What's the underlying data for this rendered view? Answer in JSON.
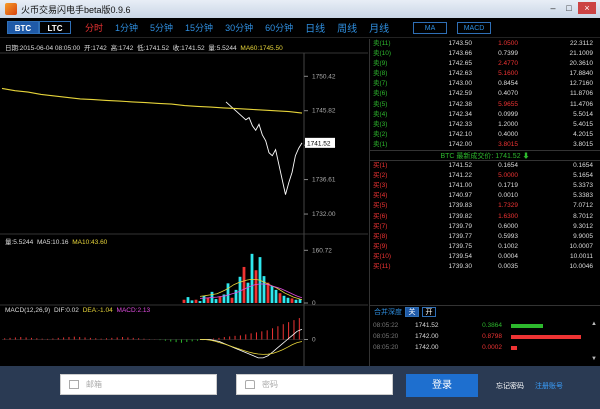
{
  "window": {
    "title": "火币交易闪电手beta版0.9.6",
    "minimize": "–",
    "maximize": "□",
    "close": "×"
  },
  "toolbar": {
    "coins": [
      "BTC",
      "LTC"
    ],
    "periods": [
      "分时",
      "1分钟",
      "5分钟",
      "15分钟",
      "30分钟",
      "60分钟",
      "日线",
      "周线",
      "月线"
    ],
    "indicators": [
      "MA",
      "MACD"
    ]
  },
  "main_info": {
    "date": "日期:2015-06-04 08:05:00",
    "open": "开:1742",
    "high": "高:1742",
    "low": "低:1741.52",
    "close": "收:1741.52",
    "volume": "量:5.5244",
    "ma60": "MA60:1745.50"
  },
  "volume_info": {
    "volume": "量:5.5244",
    "ma5": "MA5:10.16",
    "ma10": "MA10:43.60"
  },
  "macd_info": {
    "params": "MACD(12,26,9)",
    "dif": "DIF:0.02",
    "dea": "DEA:-1.04",
    "macd": "MACD:2.13"
  },
  "chart_data": [
    {
      "type": "line",
      "name": "price",
      "current_price": "1741.52",
      "y_ticks": [
        "1750.42",
        "1745.82",
        "1741.21",
        "1736.61",
        "1732.00"
      ],
      "ylim": [
        1730,
        1753
      ],
      "series": [
        {
          "name": "close",
          "color": "#ffffff",
          "values": [
            1747.0,
            1746.6,
            1746.2,
            1745.8,
            1745.4,
            1745.0,
            1744.6,
            1744.9,
            1743.8,
            1743.2,
            1744.0,
            1742.6,
            1741.8,
            1740.2,
            1739.8,
            1740.6,
            1738.6,
            1736.6,
            1734.6,
            1736.2,
            1737.6,
            1739.8,
            1740.8,
            1741.52
          ]
        },
        {
          "name": "MA60",
          "color": "#e6d43a",
          "values": [
            1748.8,
            1748.5,
            1748.3,
            1748.0,
            1747.8,
            1747.6,
            1747.4,
            1747.3,
            1747.2,
            1747.1,
            1747.0,
            1746.9,
            1746.8,
            1746.7,
            1746.5,
            1746.4,
            1746.3,
            1746.2,
            1746.1,
            1746.0,
            1745.9,
            1745.8,
            1745.7,
            1745.5
          ]
        }
      ]
    },
    {
      "type": "bar",
      "name": "volume",
      "y_ticks": [
        "160.72",
        "0"
      ],
      "ylim": [
        0,
        180
      ],
      "values": [
        0,
        0,
        0,
        0,
        0,
        0,
        0,
        0,
        0,
        0,
        0,
        0,
        0,
        0,
        0,
        0,
        0,
        0,
        0,
        0,
        0,
        0,
        0,
        0,
        0,
        0,
        0,
        0,
        0,
        0,
        0,
        0,
        0,
        0,
        0,
        0,
        0,
        0,
        0,
        0,
        0,
        0,
        0,
        0,
        0,
        10,
        18,
        8,
        10,
        6,
        22,
        16,
        34,
        12,
        20,
        26,
        60,
        16,
        40,
        80,
        110,
        62,
        150,
        100,
        140,
        82,
        62,
        52,
        40,
        30,
        22,
        16,
        14,
        10,
        12
      ],
      "series": [
        {
          "name": "MA5",
          "color": "#e6d43a",
          "values": [
            20,
            22,
            24,
            26,
            28,
            34,
            40,
            48,
            56,
            62,
            66,
            70,
            72,
            72,
            70,
            64,
            58,
            52,
            46,
            38,
            30,
            24,
            18,
            14,
            10
          ]
        },
        {
          "name": "MA10",
          "color": "#e04ce0",
          "values": [
            14,
            15,
            16,
            17,
            18,
            20,
            22,
            26,
            30,
            34,
            40,
            46,
            52,
            56,
            58,
            58,
            56,
            52,
            48,
            44,
            38,
            32,
            26,
            20,
            16
          ]
        }
      ]
    },
    {
      "type": "bar",
      "name": "MACD",
      "y_ticks": [
        "0"
      ],
      "ylim": [
        -12,
        12
      ],
      "values": [
        0.6,
        0.8,
        1.0,
        1.2,
        1.0,
        0.8,
        0.6,
        0.4,
        0.3,
        0.5,
        0.8,
        1.0,
        1.2,
        1.4,
        1.2,
        1.0,
        0.8,
        0.6,
        0.4,
        0.6,
        0.8,
        1.0,
        1.2,
        1.0,
        0.8,
        0.6,
        0.4,
        0.2,
        0.1,
        -0.3,
        -0.6,
        -1.0,
        -1.3,
        -1.6,
        -1.2,
        -0.9,
        -0.6,
        -0.3,
        0.2,
        0.5,
        0.8,
        1.2,
        1.5,
        1.8,
        2.0,
        2.5,
        3.0,
        3.5,
        4.0,
        4.5,
        5.5,
        6.5,
        7.5,
        8.5,
        9.5,
        10.5
      ],
      "series": [
        {
          "name": "DIF",
          "color": "#ffffff",
          "values": [
            0,
            0,
            0,
            -0.5,
            -1,
            -2,
            -3,
            -4,
            -5,
            -6,
            -7,
            -8,
            -9,
            -9,
            -8,
            -6,
            -4,
            -2,
            0,
            2,
            4,
            5
          ]
        },
        {
          "name": "DEA",
          "color": "#e6d43a",
          "values": [
            0,
            0,
            -0.3,
            -0.8,
            -1.5,
            -2.2,
            -3,
            -3.8,
            -4.6,
            -5.4,
            -6.1,
            -6.7,
            -7.1,
            -7.3,
            -7.2,
            -6.8,
            -6,
            -5,
            -3.8,
            -2.5,
            -1.5,
            -1
          ]
        }
      ]
    }
  ],
  "order_book": {
    "mid_label": "BTC 最新成交价:",
    "mid_price": "1741.52",
    "mid_arrow": "⬇",
    "asks": [
      {
        "label": "卖(11)",
        "price": "1743.50",
        "size": "1.0500",
        "total": "22.3112",
        "size_color": "red"
      },
      {
        "label": "卖(10)",
        "price": "1743.66",
        "size": "0.7399",
        "total": "21.1009",
        "size_color": ""
      },
      {
        "label": "卖(9)",
        "price": "1742.65",
        "size": "2.4770",
        "total": "20.3610",
        "size_color": "red"
      },
      {
        "label": "卖(8)",
        "price": "1742.63",
        "size": "5.1600",
        "total": "17.8840",
        "size_color": "red"
      },
      {
        "label": "卖(7)",
        "price": "1743.00",
        "size": "0.8454",
        "total": "12.7160",
        "size_color": ""
      },
      {
        "label": "卖(6)",
        "price": "1742.59",
        "size": "0.4070",
        "total": "11.8706",
        "size_color": ""
      },
      {
        "label": "卖(5)",
        "price": "1742.38",
        "size": "5.9655",
        "total": "11.4706",
        "size_color": "red"
      },
      {
        "label": "卖(4)",
        "price": "1742.34",
        "size": "0.0999",
        "total": "5.5014",
        "size_color": ""
      },
      {
        "label": "卖(3)",
        "price": "1742.33",
        "size": "1.2000",
        "total": "5.4015",
        "size_color": ""
      },
      {
        "label": "卖(2)",
        "price": "1742.10",
        "size": "0.4000",
        "total": "4.2015",
        "size_color": ""
      },
      {
        "label": "卖(1)",
        "price": "1742.00",
        "size": "3.8015",
        "total": "3.8015",
        "size_color": "red"
      }
    ],
    "bids": [
      {
        "label": "买(1)",
        "price": "1741.52",
        "size": "0.1654",
        "total": "0.1654",
        "size_color": ""
      },
      {
        "label": "买(2)",
        "price": "1741.22",
        "size": "5.0000",
        "total": "5.1654",
        "size_color": "red"
      },
      {
        "label": "买(3)",
        "price": "1741.00",
        "size": "0.1719",
        "total": "5.3373",
        "size_color": ""
      },
      {
        "label": "买(4)",
        "price": "1740.97",
        "size": "0.0010",
        "total": "5.3383",
        "size_color": ""
      },
      {
        "label": "买(5)",
        "price": "1739.83",
        "size": "1.7329",
        "total": "7.0712",
        "size_color": "red"
      },
      {
        "label": "买(6)",
        "price": "1739.82",
        "size": "1.6300",
        "total": "8.7012",
        "size_color": "red"
      },
      {
        "label": "买(7)",
        "price": "1739.79",
        "size": "0.6000",
        "total": "9.3012",
        "size_color": ""
      },
      {
        "label": "买(8)",
        "price": "1739.77",
        "size": "0.5993",
        "total": "9.9005",
        "size_color": ""
      },
      {
        "label": "买(9)",
        "price": "1739.75",
        "size": "0.1002",
        "total": "10.0007",
        "size_color": ""
      },
      {
        "label": "买(10)",
        "price": "1739.54",
        "size": "0.0004",
        "total": "10.0011",
        "size_color": ""
      },
      {
        "label": "买(11)",
        "price": "1739.30",
        "size": "0.0035",
        "total": "10.0046",
        "size_color": ""
      }
    ]
  },
  "trades": {
    "merge_label": "合并深度",
    "toggle_off": "关",
    "toggle_on": "开",
    "rows": [
      {
        "time": "08:05:22",
        "price": "1741.52",
        "volume": "0.3864",
        "color": "#2db82d",
        "bar_fraction": 0.45
      },
      {
        "time": "08:05:20",
        "price": "1742.00",
        "volume": "0.8798",
        "color": "#e33",
        "bar_fraction": 1.0
      },
      {
        "time": "08:05:20",
        "price": "1742.00",
        "volume": "0.0002",
        "color": "#e33",
        "bar_fraction": 0.08
      }
    ]
  },
  "login": {
    "email_placeholder": "邮箱",
    "password_placeholder": "密码",
    "login_button": "登录",
    "forgot": "忘记密码",
    "register": "注册账号"
  }
}
